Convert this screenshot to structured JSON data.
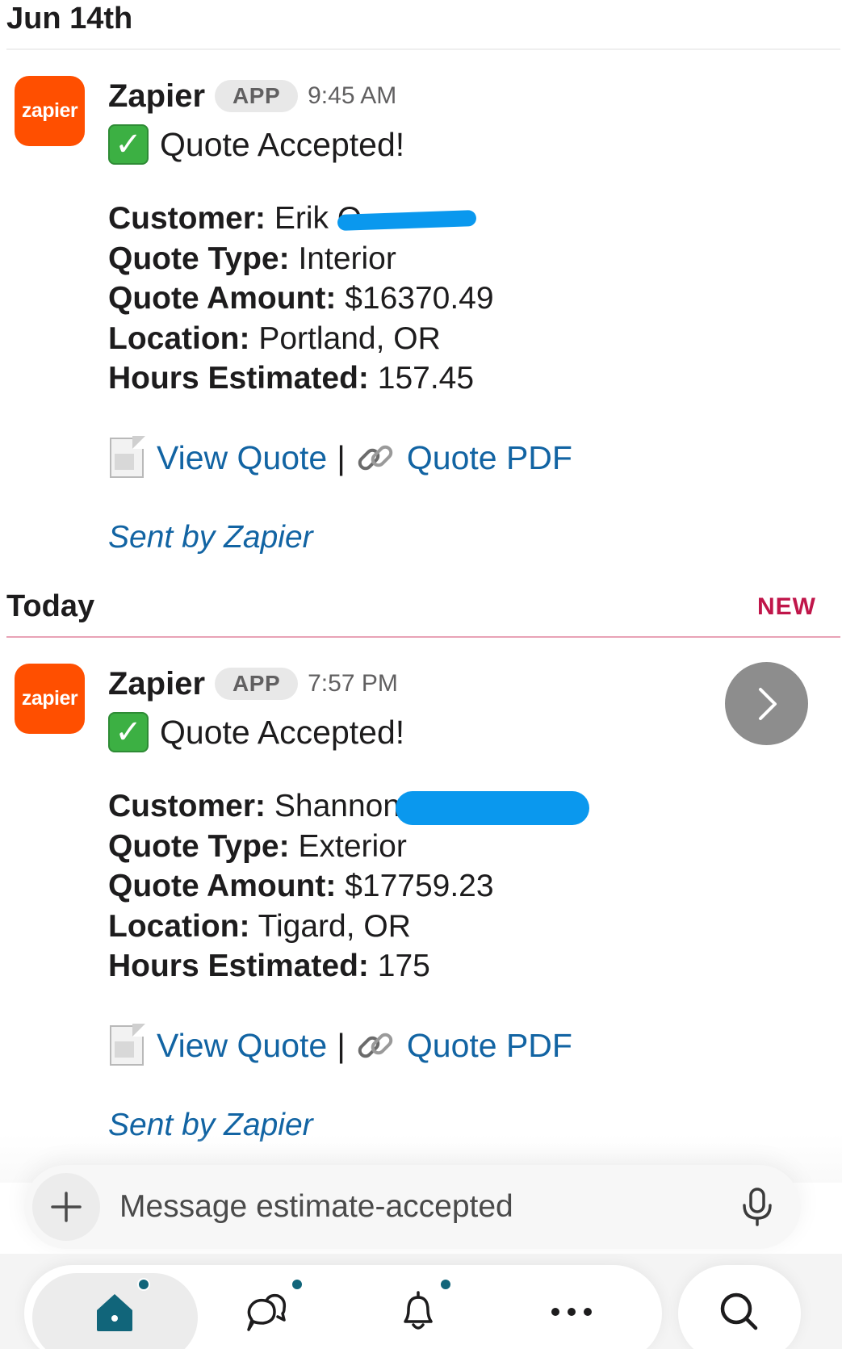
{
  "sections": [
    {
      "date_label": "Jun 14th",
      "message": {
        "avatar_text": "zapier",
        "sender": "Zapier",
        "badge": "APP",
        "time": "9:45 AM",
        "title": "Quote Accepted!",
        "check_icon": "✓",
        "fields": {
          "customer_label": "Customer:",
          "customer_value": "Erik O",
          "type_label": "Quote Type:",
          "type_value": "Interior",
          "amount_label": "Quote Amount:",
          "amount_value": "$16370.49",
          "location_label": "Location:",
          "location_value": "Portland, OR",
          "hours_label": "Hours Estimated:",
          "hours_value": "157.45"
        },
        "view_quote": "View Quote",
        "separator": "|",
        "quote_pdf": "Quote PDF",
        "sent_by": "Sent by Zapier"
      }
    },
    {
      "date_label": "Today",
      "new_label": "NEW",
      "message": {
        "avatar_text": "zapier",
        "sender": "Zapier",
        "badge": "APP",
        "time": "7:57 PM",
        "title": "Quote Accepted!",
        "check_icon": "✓",
        "fields": {
          "customer_label": "Customer:",
          "customer_value": "Shannon",
          "type_label": "Quote Type:",
          "type_value": "Exterior",
          "amount_label": "Quote Amount:",
          "amount_value": "$17759.23",
          "location_label": "Location:",
          "location_value": "Tigard, OR",
          "hours_label": "Hours Estimated:",
          "hours_value": "175"
        },
        "view_quote": "View Quote",
        "separator": "|",
        "quote_pdf": "Quote PDF",
        "sent_by": "Sent by Zapier"
      }
    }
  ],
  "composer": {
    "placeholder": "Message estimate-accepted",
    "plus_icon": "plus-icon",
    "mic_icon": "microphone-icon"
  },
  "tabbar": {
    "tabs": [
      "home-icon",
      "dms-icon",
      "activity-bell-icon",
      "more-icon"
    ],
    "search_icon": "search-icon"
  },
  "colors": {
    "zapier_orange": "#ff4f00",
    "link_blue": "#1264a3",
    "new_red": "#c0164a",
    "redaction_blue": "#0a98ee",
    "tab_dot": "#11657a",
    "home_icon": "#11657a"
  }
}
